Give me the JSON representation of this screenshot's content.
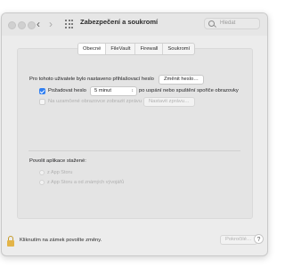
{
  "window": {
    "title": "Zabezpečení a soukromí"
  },
  "search": {
    "placeholder": "Hledat"
  },
  "tabs": [
    {
      "label": "Obecné",
      "active": true
    },
    {
      "label": "FileVault"
    },
    {
      "label": "Firewall"
    },
    {
      "label": "Soukromí"
    }
  ],
  "general": {
    "password_info": "Pro tohoto uživatele bylo nastaveno přihlašovací heslo",
    "change_password_label": "Změnit heslo…",
    "require_password": {
      "label": "Požadovat heslo",
      "checked": true,
      "value": "5 minut",
      "suffix": "po uspání nebo spuštění spořiče obrazovky"
    },
    "lock_message": {
      "label": "Na uzamčené obrazovce zobrazit zprávu",
      "checked": false,
      "button_label": "Nastavit zprávu…"
    },
    "allow_apps": {
      "title": "Povolit aplikace stažené:",
      "options": [
        "z App Storu",
        "z App Storu a od známých vývojářů"
      ]
    }
  },
  "footer": {
    "lock_text": "Kliknutím na zámek povolíte změny.",
    "advanced_label": "Pokročilé…",
    "help_label": "?"
  },
  "icons": {
    "back": "chevron-left-icon",
    "forward": "chevron-right-icon",
    "grid": "grid-icon",
    "search": "search-icon",
    "lock": "lock-icon",
    "dropdown": "chevron-updown-icon"
  },
  "colors": {
    "accent": "#2f7ff2",
    "lock": "#e3b448",
    "disabled_text": "#b0b0b0"
  }
}
